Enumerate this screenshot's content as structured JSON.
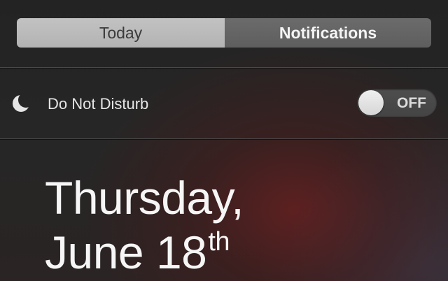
{
  "tabs": {
    "today_label": "Today",
    "notifications_label": "Notifications",
    "selected": "Notifications"
  },
  "do_not_disturb": {
    "label": "Do Not Disturb",
    "toggle_state": "OFF",
    "icon": "moon-icon"
  },
  "date": {
    "line1": "Thursday,",
    "line2": "June 18",
    "suffix": "th"
  },
  "colors": {
    "tab_inactive_bg": "#b8b8b8",
    "tab_active_bg": "#636363",
    "text_primary": "#f4f4f4"
  }
}
